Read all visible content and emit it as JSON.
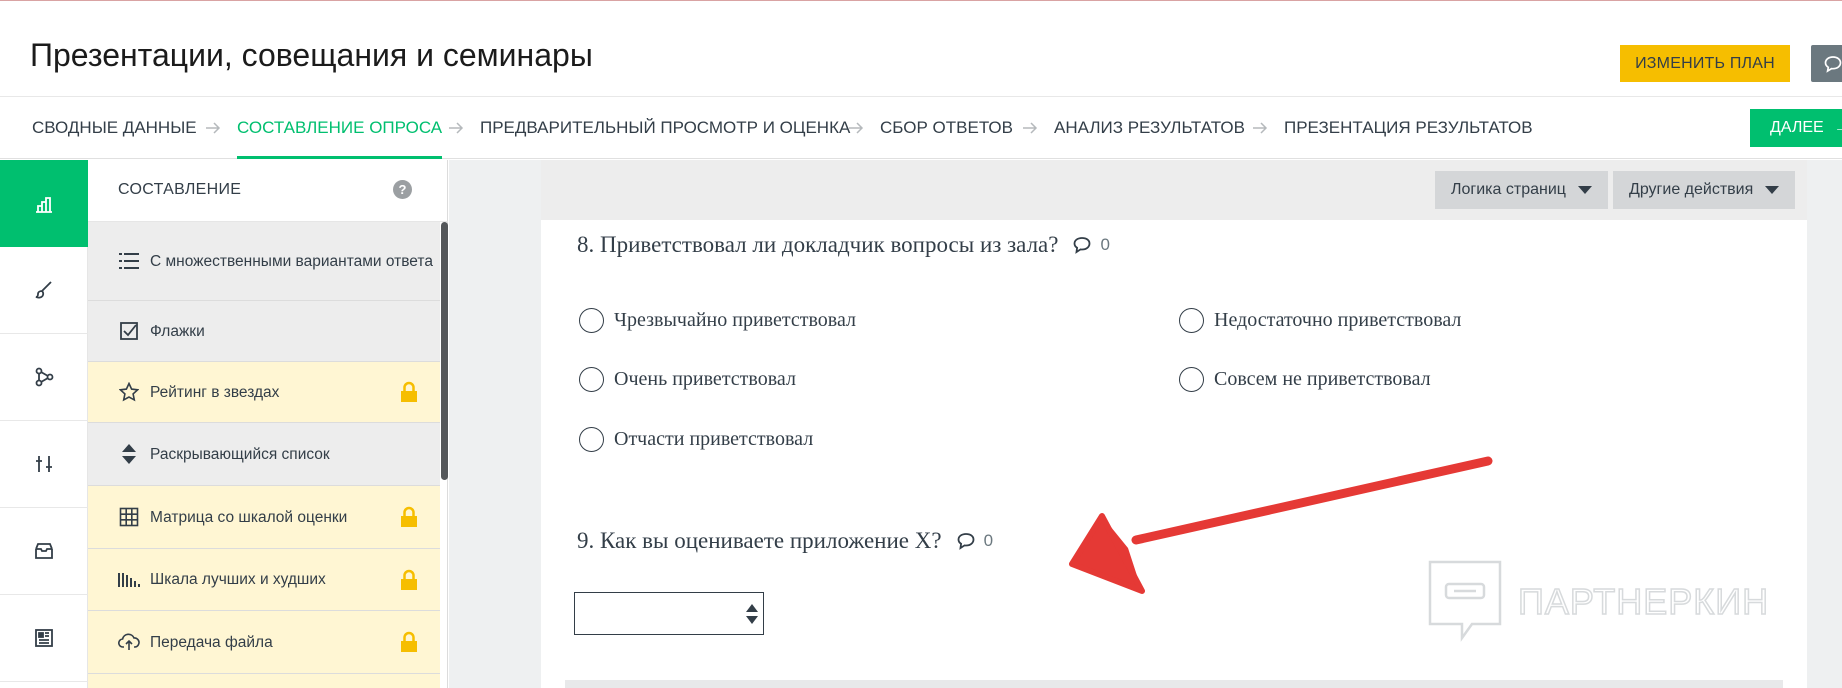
{
  "header": {
    "title": "Презентации, совещания и семинары",
    "change_plan_label": "ИЗМЕНИТЬ ПЛАН"
  },
  "steps": {
    "items": [
      {
        "label": "СВОДНЫЕ ДАННЫЕ",
        "active": false
      },
      {
        "label": "СОСТАВЛЕНИЕ ОПРОСА",
        "active": true
      },
      {
        "label": "ПРЕДВАРИТЕЛЬНЫЙ ПРОСМОТР И ОЦЕНКА",
        "active": false
      },
      {
        "label": "СБОР ОТВЕТОВ",
        "active": false
      },
      {
        "label": "АНАЛИЗ РЕЗУЛЬТАТОВ",
        "active": false
      },
      {
        "label": "ПРЕЗЕНТАЦИЯ РЕЗУЛЬТАТОВ",
        "active": false
      }
    ],
    "next_label": "ДАЛЕЕ"
  },
  "rail": {
    "items": [
      {
        "icon": "build-icon",
        "active": true
      },
      {
        "icon": "brush-icon",
        "active": false
      },
      {
        "icon": "logic-icon",
        "active": false
      },
      {
        "icon": "options-sliders-icon",
        "active": false
      },
      {
        "icon": "question-bank-icon",
        "active": false
      },
      {
        "icon": "layout-icon",
        "active": false
      }
    ]
  },
  "panel": {
    "title": "СОСТАВЛЕНИЕ",
    "help": "?",
    "items": [
      {
        "label": "С множественными вариантами ответа",
        "icon": "list-icon",
        "locked": false
      },
      {
        "label": "Флажки",
        "icon": "checkbox-icon",
        "locked": false
      },
      {
        "label": "Рейтинг в звездах",
        "icon": "star-icon",
        "locked": true
      },
      {
        "label": "Раскрывающийся список",
        "icon": "dropdown-arrows-icon",
        "locked": false
      },
      {
        "label": "Матрица со шкалой оценки",
        "icon": "grid-icon",
        "locked": true
      },
      {
        "label": "Шкала лучших и худших",
        "icon": "best-worst-scale-icon",
        "locked": true
      },
      {
        "label": "Передача файла",
        "icon": "cloud-upload-icon",
        "locked": true
      }
    ]
  },
  "toolbar": {
    "page_logic_label": "Логика страниц",
    "other_actions_label": "Другие действия"
  },
  "questions": [
    {
      "number": "8.",
      "text": "Приветствовал ли докладчик вопросы из зала?",
      "comments": "0",
      "options": [
        "Чрезвычайно приветствовал",
        "Недостаточно приветствовал",
        "Очень приветствовал",
        "Совсем не приветствовал",
        "Отчасти приветствовал"
      ]
    },
    {
      "number": "9.",
      "text": "Как вы оцениваете приложение X?",
      "comments": "0",
      "dropdown_value": ""
    }
  ],
  "watermark": {
    "text": "ПАРТНЕРКИН"
  },
  "colors": {
    "accent_green": "#00bf6f",
    "plan_yellow": "#f6be00",
    "locked_bg": "#fff6d3",
    "annotation_red": "#e53935"
  }
}
